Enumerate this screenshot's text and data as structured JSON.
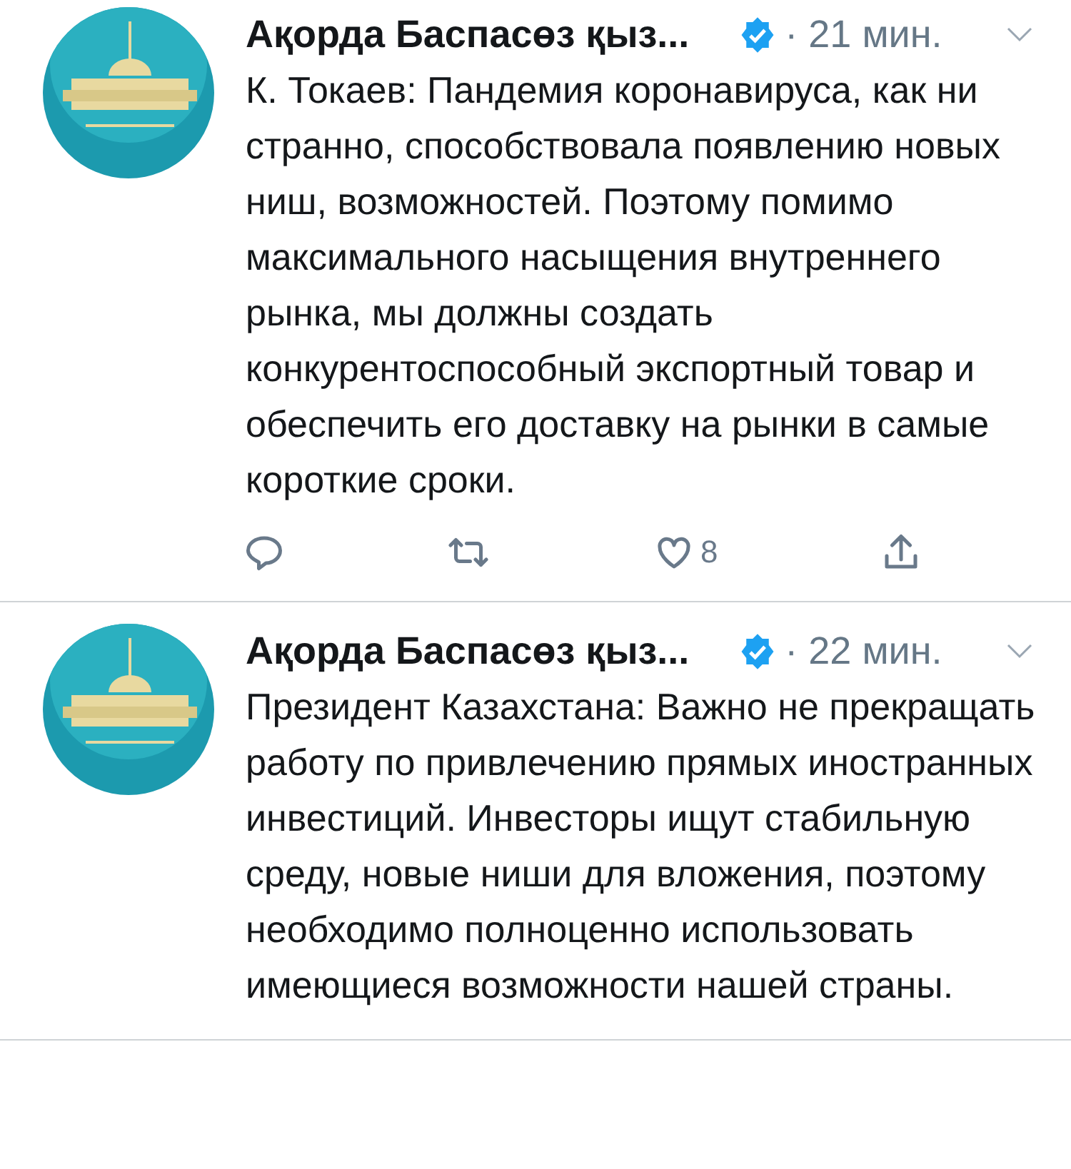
{
  "tweets": [
    {
      "author": "Ақорда Баспасөз қыз...",
      "verified": true,
      "time": "· 21 мин.",
      "text": "К. Токаев:  Пандемия коронавируса, как ни странно, способствовала появлению новых ниш, возможностей. Поэтому помимо максимального насыщения внутреннего рынка, мы должны создать конкурентоспособный экспортный товар и обеспечить его доставку на рынки в самые короткие сроки.",
      "actions": [
        {
          "kind": "reply"
        },
        {
          "kind": "retweet"
        },
        {
          "kind": "like",
          "count": "8"
        },
        {
          "kind": "share"
        }
      ]
    },
    {
      "author": "Ақорда Баспасөз қыз...",
      "verified": true,
      "time": "· 22 мин.",
      "text": "Президент Казахстана:  Важно не прекращать работу по привлечению прямых иностранных инвестиций. Инвесторы ищут стабильную среду, новые ниши для вложения, поэтому необходимо полноценно использовать имеющиеся возможности нашей страны."
    }
  ]
}
